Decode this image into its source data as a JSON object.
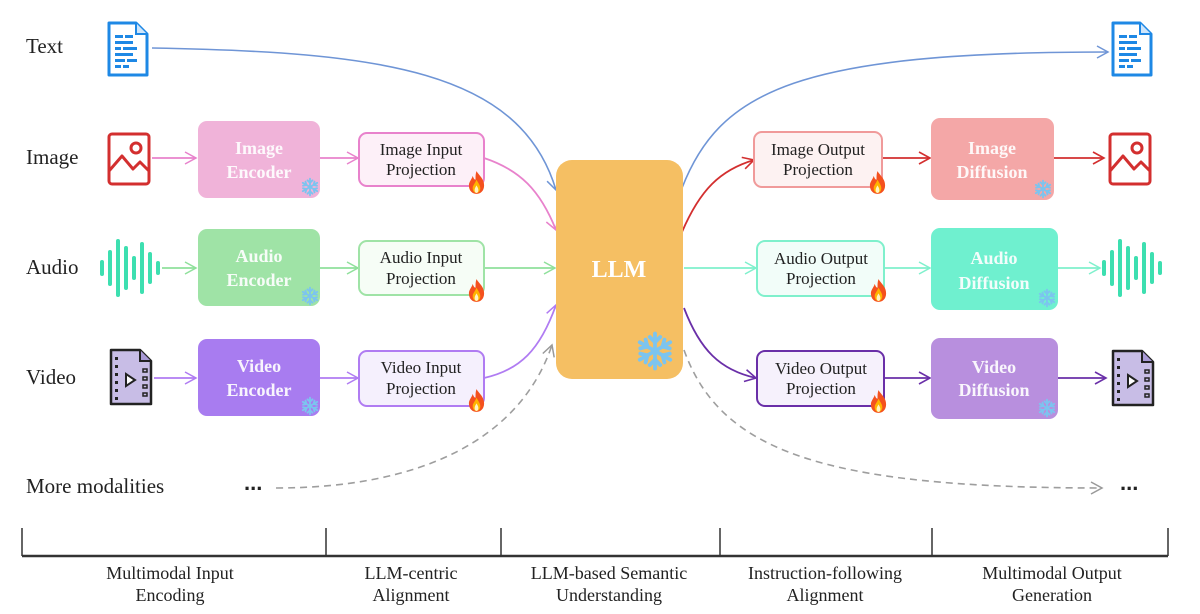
{
  "colors": {
    "text": "#1e88e5",
    "image": "#d32f2f",
    "image_enc": "#f0b3d9",
    "image_dif": "#f4a7a7",
    "audio": "#3ddfb0",
    "audio_enc": "#9fe3a6",
    "audio_dif": "#6ff0cf",
    "video": "#7b3fb8",
    "video_enc": "#a87cf0",
    "video_dif": "#b88fde",
    "llm": "#f5bf63",
    "snow": "#7cc4ef"
  },
  "modalities": {
    "text": "Text",
    "image": "Image",
    "audio": "Audio",
    "video": "Video",
    "more": "More modalities",
    "ellipsis": "..."
  },
  "encoders": {
    "image": [
      "Image",
      "Encoder"
    ],
    "audio": [
      "Audio",
      "Encoder"
    ],
    "video": [
      "Video",
      "Encoder"
    ]
  },
  "input_projections": {
    "image": [
      "Image Input",
      "Projection"
    ],
    "audio": [
      "Audio Input",
      "Projection"
    ],
    "video": [
      "Video Input",
      "Projection"
    ]
  },
  "llm": "LLM",
  "output_projections": {
    "image": [
      "Image Output",
      "Projection"
    ],
    "audio": [
      "Audio Output",
      "Projection"
    ],
    "video": [
      "Video Output",
      "Projection"
    ]
  },
  "diffusions": {
    "image": [
      "Image",
      "Diffusion"
    ],
    "audio": [
      "Audio",
      "Diffusion"
    ],
    "video": [
      "Video",
      "Diffusion"
    ]
  },
  "icons": {
    "frozen": "snowflake-icon",
    "trainable": "fire-icon"
  },
  "stages": [
    [
      "Multimodal Input",
      "Encoding"
    ],
    [
      "LLM-centric",
      "Alignment"
    ],
    [
      "LLM-based Semantic",
      "Understanding"
    ],
    [
      "Instruction-following",
      "Alignment"
    ],
    [
      "Multimodal Output",
      "Generation"
    ]
  ]
}
